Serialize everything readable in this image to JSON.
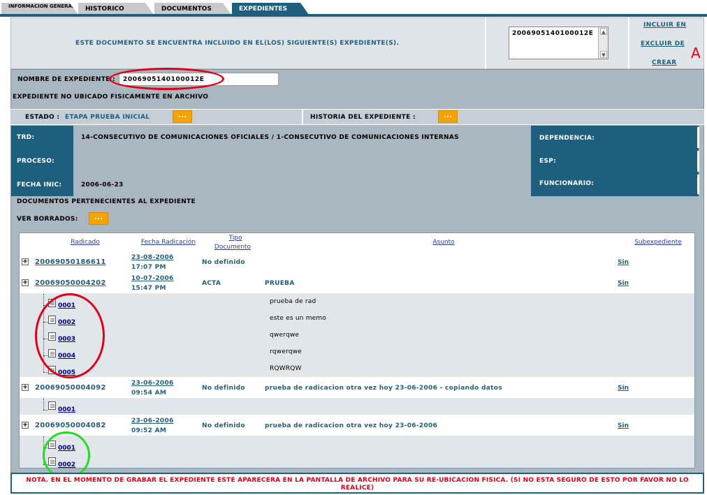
{
  "tabs": [
    {
      "label": "INFORMACION GENERAL",
      "active": false
    },
    {
      "label": "HISTORICO",
      "active": false
    },
    {
      "label": "DOCUMENTOS",
      "active": false
    },
    {
      "label": "EXPEDIENTES",
      "active": true
    }
  ],
  "header": {
    "message": "ESTE DOCUMENTO SE ENCUENTRA INCLUIDO EN EL(LOS) SIGUIENTE(S) EXPEDIENTE(S).",
    "list_value": "2006905140100012E",
    "links": [
      "INCLUIR EN",
      "EXCLUIR DE",
      "CREAR"
    ],
    "annotation_letter": "A"
  },
  "expediente": {
    "name_label": "NOMBRE DE EXPEDIENTE :",
    "name_value": "2006905140100012E",
    "ubicacion": "EXPEDIENTE NO UBICADO FISICAMENTE EN ARCHIVO",
    "estado_label": "ESTADO :",
    "estado_value": "ETAPA PRUEBA INICIAL",
    "historia_label": "HISTORIA DEL EXPEDIENTE :",
    "button_label": "..."
  },
  "info": {
    "trd_label": "TRD:",
    "trd_value": "14-CONSECUTIVO DE COMUNICACIONES OFICIALES / 1-CONSECUTIVO DE COMUNICACIONES INTERNAS",
    "proceso_label": "PROCESO:",
    "proceso_value": "",
    "fecha_label": "FECHA INIC:",
    "fecha_value": "2006-06-23",
    "dependencia_label": "DEPENDENCIA:",
    "esp_label": "ESP:",
    "funcionario_label": "FUNCIONARIO:"
  },
  "documentos": {
    "title": "DOCUMENTOS PERTENECIENTES AL EXPEDIENTE",
    "ver_borrados_label": "VER BORRADOS:",
    "columns": {
      "radicado": "Radicado",
      "fecha": "Fecha Radicación",
      "tipo_line1": "Tipo",
      "tipo_line2": "Documento",
      "asunto": "Asunto",
      "subexpediente": "Subexpediente"
    },
    "rows": [
      {
        "radicado": "20069050186611",
        "fecha": "23-08-2006",
        "hora": "17:07 PM",
        "tipo": "No definido",
        "asunto": "",
        "sub": "Sin"
      },
      {
        "radicado": "20069050004202",
        "fecha": "10-07-2006",
        "hora": "15:47 PM",
        "tipo": "ACTA",
        "asunto": "PRUEBA",
        "sub": "Sin"
      },
      {
        "radicado": "20069050004092",
        "fecha": "23-06-2006",
        "hora": "09:54 AM",
        "tipo": "No definido",
        "asunto": "prueba de radicacion otra vez hoy 23-06-2006 - copiando datos",
        "sub": "Sin"
      },
      {
        "radicado": "20069050004082",
        "fecha": "23-06-2006",
        "hora": "09:52 AM",
        "tipo": "No definido",
        "asunto": "prueba de radicacion otra vez hoy 23-06-2006",
        "sub": "Sin"
      }
    ],
    "anexos_row2": [
      {
        "num": "0001",
        "desc": "prueba de rad"
      },
      {
        "num": "0002",
        "desc": "este es un memo"
      },
      {
        "num": "0003",
        "desc": "qwerqwe"
      },
      {
        "num": "0004",
        "desc": "rqwerqwe"
      },
      {
        "num": "0005",
        "desc": "RQWRQW"
      }
    ],
    "anexos_row3": [
      {
        "num": "0001"
      }
    ],
    "anexos_row4": [
      {
        "num": "0001"
      },
      {
        "num": "0002"
      }
    ]
  },
  "nota": "NOTA. EN EL MOMENTO DE GRABAR EL EXPEDIENTE ESTE APARECERA EN LA PANTALLA DE ARCHIVO PARA SU RE-UBICACION FISICA. (SI NO ESTA SEGURO DE ESTO POR FAVOR NO LO REALICE)",
  "colors": {
    "accent": "#1f5f7e",
    "button": "#f4a300",
    "annotation_red": "#e0001a",
    "annotation_green": "#22dd22"
  }
}
